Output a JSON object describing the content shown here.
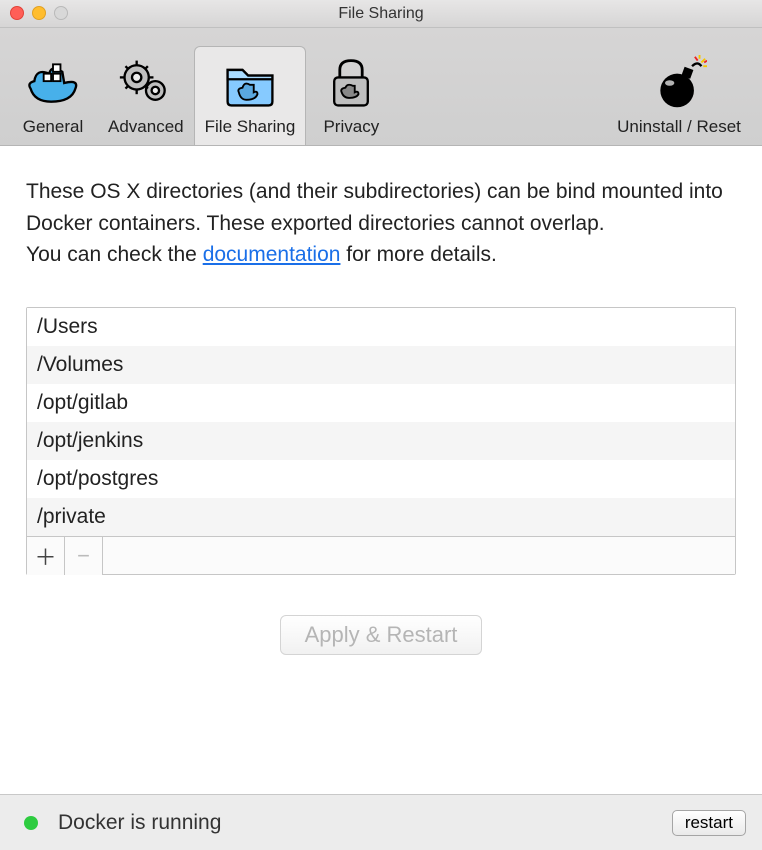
{
  "window": {
    "title": "File Sharing"
  },
  "tabs": {
    "general": "General",
    "advanced": "Advanced",
    "filesharing": "File Sharing",
    "privacy": "Privacy",
    "uninstall": "Uninstall / Reset",
    "active": "filesharing"
  },
  "description": {
    "p1": "These OS X directories (and their subdirectories) can be bind mounted into Docker containers. These exported directories cannot overlap.",
    "p2a": "You can check the ",
    "link": "documentation",
    "p2b": " for more details."
  },
  "directories": [
    "/Users",
    "/Volumes",
    "/opt/gitlab",
    "/opt/jenkins",
    "/opt/postgres",
    "/private"
  ],
  "buttons": {
    "add": "＋",
    "remove": "−",
    "apply": "Apply & Restart",
    "restart": "restart"
  },
  "status": {
    "text": "Docker is running",
    "color": "#2ecc40"
  }
}
